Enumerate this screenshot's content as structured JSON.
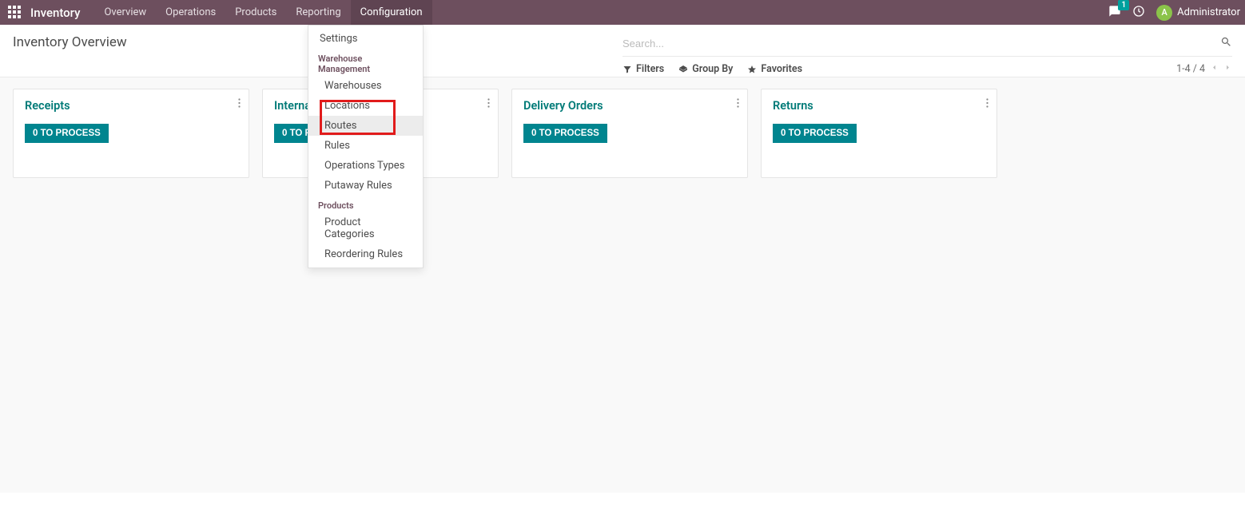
{
  "navbar": {
    "brand": "Inventory",
    "menu": [
      {
        "label": "Overview",
        "active": false
      },
      {
        "label": "Operations",
        "active": false
      },
      {
        "label": "Products",
        "active": false
      },
      {
        "label": "Reporting",
        "active": false
      },
      {
        "label": "Configuration",
        "active": true
      }
    ],
    "chat_badge": "1",
    "user_initial": "A",
    "user_name": "Administrator"
  },
  "dropdown": {
    "settings": "Settings",
    "group_wm": "Warehouse Management",
    "warehouses": "Warehouses",
    "locations": "Locations",
    "routes": "Routes",
    "rules": "Rules",
    "ops_types": "Operations Types",
    "putaway": "Putaway Rules",
    "group_products": "Products",
    "product_categories": "Product Categories",
    "reordering": "Reordering Rules"
  },
  "control": {
    "title": "Inventory Overview",
    "search_placeholder": "Search...",
    "filters": "Filters",
    "groupby": "Group By",
    "favorites": "Favorites",
    "pager": "1-4 / 4"
  },
  "cards": [
    {
      "title": "Receipts",
      "button": "0 TO PROCESS"
    },
    {
      "title": "Interna",
      "button": "0 TO PR"
    },
    {
      "title": "Delivery Orders",
      "button": "0 TO PROCESS"
    },
    {
      "title": "Returns",
      "button": "0 TO PROCESS"
    }
  ]
}
